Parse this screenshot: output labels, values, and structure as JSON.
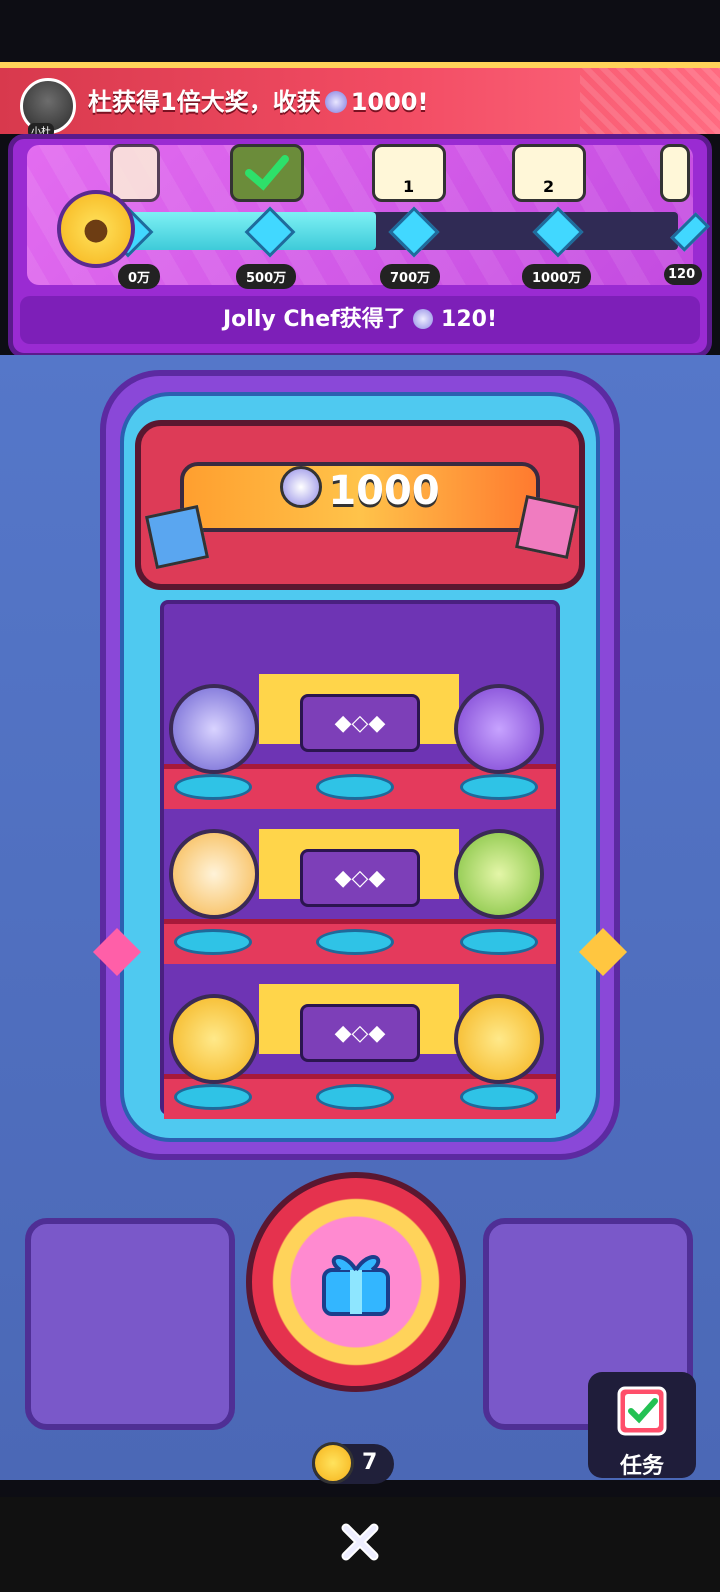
{
  "banner": {
    "avatar_name": "小杜",
    "text_before": "杜获得1倍大奖，收获",
    "text_amount": "1000!"
  },
  "progress": {
    "ticks": [
      "0万",
      "500万",
      "700万",
      "1000万",
      "120"
    ],
    "rewards": [
      {
        "badge": ""
      },
      {
        "badge": ""
      },
      {
        "badge": "1"
      },
      {
        "badge": "2"
      },
      {
        "badge": ""
      }
    ],
    "fill_fraction": 0.46
  },
  "announce": {
    "name": "Jolly Chef获得了",
    "amount": "120!"
  },
  "machine": {
    "prize_amount": "1000"
  },
  "play_count": "7",
  "task_label": "任务",
  "colors": {
    "banner": "#f24c63",
    "panel": "#9a2bd2",
    "track_fill": "#3ecbd9",
    "machine": "#8a48d8"
  }
}
